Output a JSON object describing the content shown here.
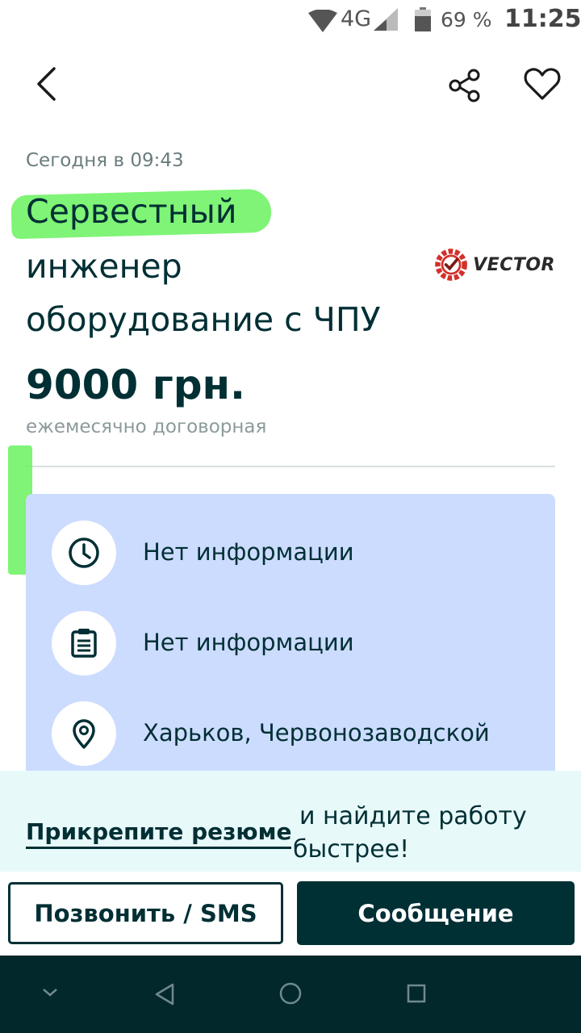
{
  "status_bar": {
    "network": "4G",
    "battery": "69 %",
    "time": "11:25"
  },
  "app_bar": {
    "back_icon": "chevron-left-icon",
    "share_icon": "share-icon",
    "favorite_icon": "heart-outline-icon"
  },
  "ad": {
    "posted": "Сегодня в 09:43",
    "title_lines": [
      "Сервестный",
      "инженер",
      "оборудование с ЧПУ"
    ],
    "logo_text": "VECTOR",
    "price": "9000 грн.",
    "price_note": "ежемесячно договорная"
  },
  "details": [
    {
      "icon": "clock-icon",
      "text": "Нет информации"
    },
    {
      "icon": "clipboard-icon",
      "text": "Нет информации"
    },
    {
      "icon": "location-pin-icon",
      "text": "Харьков, Червонозаводской"
    }
  ],
  "promo": {
    "link": "Прикрепите резюме",
    "text_line1": "и найдите работу",
    "text_line2": "быстрее!"
  },
  "actions": {
    "call": "Позвонить / SMS",
    "message": "Сообщение"
  },
  "colors": {
    "primary": "#002f34",
    "card_bg": "#ccdcff",
    "highlight": "#69f25e",
    "promo_bg": "#e8f9fa",
    "nav_bg": "#03282c"
  }
}
